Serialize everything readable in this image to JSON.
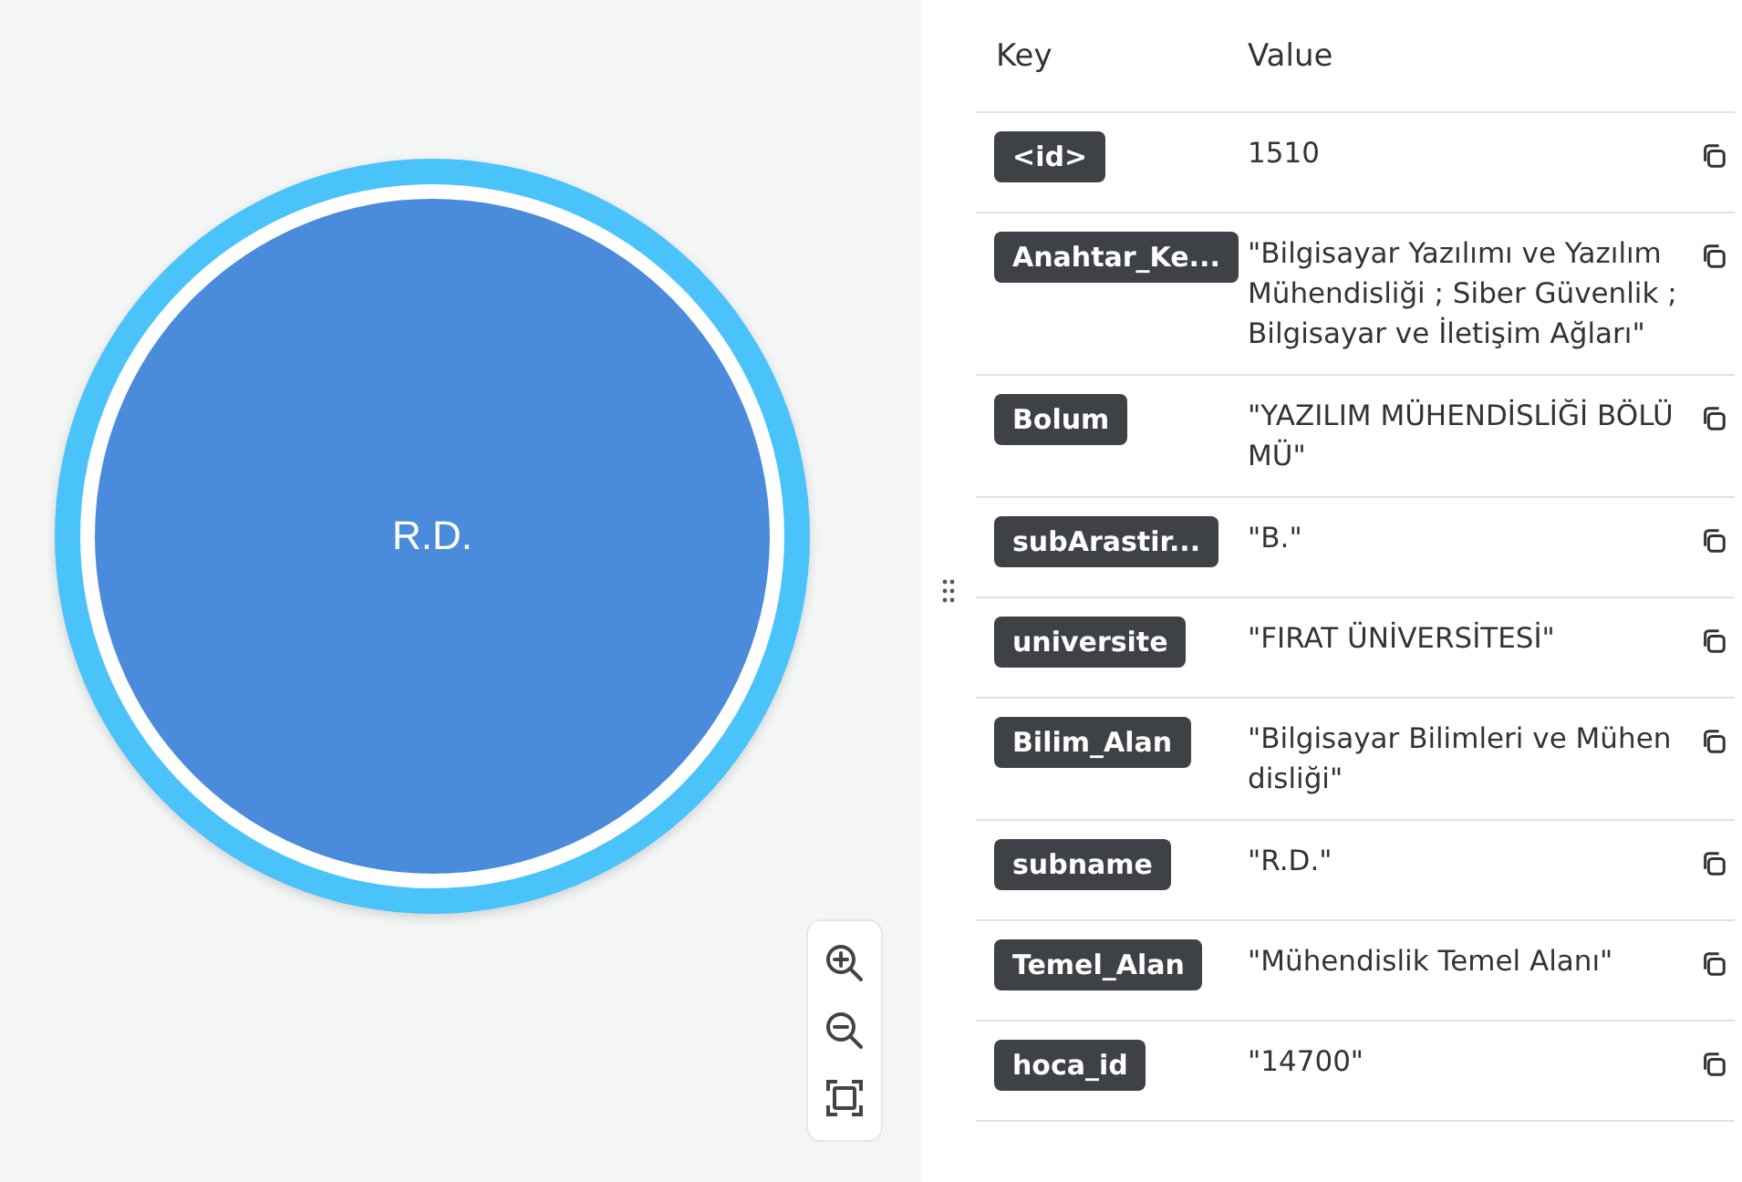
{
  "graph": {
    "node": {
      "label": "R.D."
    }
  },
  "table": {
    "columns": [
      "Key",
      "Value"
    ],
    "rows": [
      {
        "key": "<id>",
        "value": "1510"
      },
      {
        "key": "Anahtar_Ke...",
        "value": "\"Bilgisayar Yazılımı ve Yazılım Mühendisliği ; Siber Güvenlik ; Bilgisayar ve İletişim Ağları\""
      },
      {
        "key": "Bolum",
        "value": "\"YAZILIM MÜHENDİSLİĞİ BÖLÜMÜ\""
      },
      {
        "key": "subArastir...",
        "value": "\"B.\""
      },
      {
        "key": "universite",
        "value": "\"FIRAT ÜNİVERSİTESİ\""
      },
      {
        "key": "Bilim_Alan",
        "value": "\"Bilgisayar Bilimleri ve Mühendisliği\""
      },
      {
        "key": "subname",
        "value": "\"R.D.\""
      },
      {
        "key": "Temel_Alan",
        "value": "\"Mühendislik Temel Alanı\""
      },
      {
        "key": "hoca_id",
        "value": "\"14700\""
      }
    ]
  }
}
